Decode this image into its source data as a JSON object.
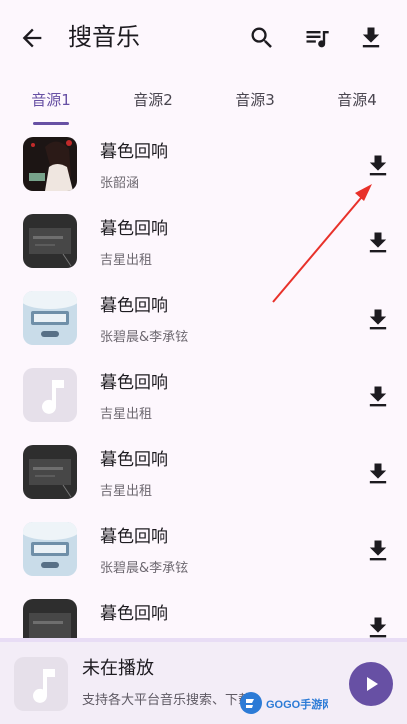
{
  "appbar": {
    "title": "搜音乐"
  },
  "tabs": [
    {
      "label": "音源1",
      "active": true
    },
    {
      "label": "音源2",
      "active": false
    },
    {
      "label": "音源3",
      "active": false
    },
    {
      "label": "音源4",
      "active": false
    }
  ],
  "songs": [
    {
      "title": "暮色回响",
      "artist": "张韶涵"
    },
    {
      "title": "暮色回响",
      "artist": "吉星出租"
    },
    {
      "title": "暮色回响",
      "artist": "张碧晨&李承铉"
    },
    {
      "title": "暮色回响",
      "artist": "吉星出租"
    },
    {
      "title": "暮色回响",
      "artist": "吉星出租"
    },
    {
      "title": "暮色回响",
      "artist": "张碧晨&李承铉"
    },
    {
      "title": "暮色回响",
      "artist": ""
    }
  ],
  "player": {
    "title": "未在播放",
    "subtitle": "支持各大平台音乐搜索、下载"
  },
  "watermark": {
    "text": "GOGO手游网"
  },
  "colors": {
    "accent": "#6750a4",
    "annotation_arrow": "#e8312a"
  }
}
